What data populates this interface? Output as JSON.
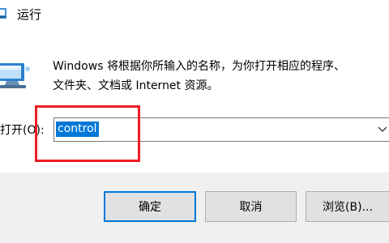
{
  "window": {
    "title": "运行"
  },
  "description": {
    "line1": "Windows 将根据你所输入的名称，为你打开相应的程序、",
    "line2": "文件夹、文档或 Internet 资源。"
  },
  "open_field": {
    "label": "打开(O):",
    "value": "control"
  },
  "buttons": {
    "ok_label": "确定",
    "cancel_label": "取消",
    "browse_label": "浏览(B)..."
  },
  "colors": {
    "accent": "#0078d7",
    "annotation_red": "#ee1c24",
    "footer_bg": "#f0f0f0"
  },
  "icons": {
    "title": "run-dialog-icon",
    "main": "run-dialog-icon",
    "dropdown": "chevron-down-icon"
  }
}
